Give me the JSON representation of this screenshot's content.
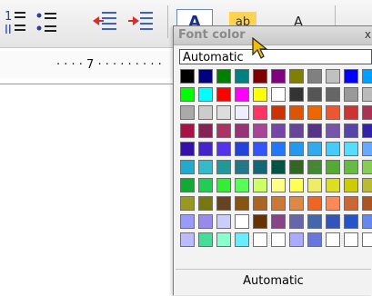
{
  "toolbar": {
    "buttons": [
      {
        "name": "numbered-list-icon"
      },
      {
        "name": "bulleted-list-icon"
      },
      {
        "name": "decrease-indent-icon"
      },
      {
        "name": "increase-indent-icon"
      },
      {
        "name": "font-color-icon",
        "glyph": "A"
      },
      {
        "name": "highlight-icon",
        "glyph": "ab"
      },
      {
        "name": "background-color-icon",
        "glyph": "A"
      }
    ]
  },
  "ruler": {
    "label": "· · · · 7 · · · · · · · · ·"
  },
  "popup": {
    "title": "Font color",
    "close": "x",
    "field_value": "Automatic",
    "button_label": "Automatic",
    "swatches": [
      [
        "#000000",
        "#000080",
        "#008000",
        "#008080",
        "#800000",
        "#800080",
        "#808000",
        "#808080",
        "#c0c0c0",
        "#0000ff",
        "#00a0ff"
      ],
      [
        "#00ff00",
        "#00ffff",
        "#ff0000",
        "#ff00ff",
        "#ffff00",
        "#ffffff",
        "#333333",
        "#555555",
        "#666666",
        "#999999",
        "#bbbbbb"
      ],
      [
        "#aaaaaa",
        "#cccccc",
        "#dddddd",
        "#eeeeff",
        "#ff3366",
        "#cc3300",
        "#dd5500",
        "#ee6600",
        "#ee5533",
        "#cc3333",
        "#aa3355"
      ],
      [
        "#aa1144",
        "#882255",
        "#aa3366",
        "#993377",
        "#aa4499",
        "#7744aa",
        "#664499",
        "#553388",
        "#7755aa",
        "#5544aa",
        "#3322aa"
      ],
      [
        "#3311aa",
        "#4422cc",
        "#5533ee",
        "#2244dd",
        "#3355ff",
        "#2277ff",
        "#2299ee",
        "#33aaee",
        "#44ccff",
        "#55ddff",
        "#66aaff"
      ],
      [
        "#22aacc",
        "#33bbcc",
        "#229999",
        "#227788",
        "#116677",
        "#005544",
        "#336622",
        "#448833",
        "#55aa33",
        "#66bb44",
        "#88cc55"
      ],
      [
        "#11aa33",
        "#22cc55",
        "#33ee33",
        "#55ff55",
        "#ccff66",
        "#ffff88",
        "#ffff55",
        "#eeee66",
        "#dddd22",
        "#cccc00",
        "#bbbb33"
      ],
      [
        "#999922",
        "#777711",
        "#664422",
        "#885511",
        "#aa6622",
        "#cc7733",
        "#dd8844",
        "#ee6622",
        "#ff8855",
        "#cc6633",
        "#aa5522"
      ],
      [
        "#9999ff",
        "#9988ee",
        "#ccccff",
        "#ffffff",
        "#663300",
        "#884488",
        "#6666aa",
        "#4466aa",
        "#3355bb",
        "#2255cc",
        "#6688ee"
      ],
      [
        "#bbbbff",
        "#44dd99",
        "#88ffcc",
        "#66eeff",
        "#ffffff",
        "#ffffff",
        "#aaaaff",
        "#6677dd",
        "#ffffff",
        "#ffffff",
        "#ffffff"
      ]
    ]
  },
  "colors": {
    "accent": "#f0c000"
  }
}
